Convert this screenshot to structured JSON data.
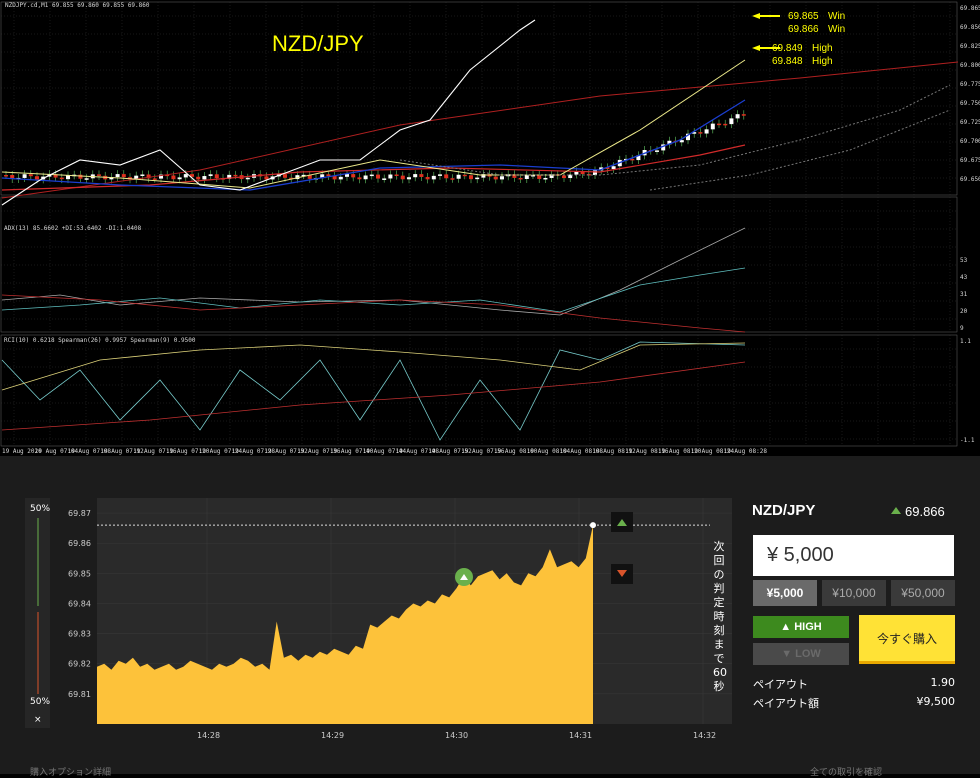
{
  "mt4": {
    "header_text": "NZDJPY.cd,M1  69.855 69.860 69.855 69.860",
    "pair_label": "NZD/JPY",
    "annotations": [
      {
        "price": "69.865",
        "label": "Win"
      },
      {
        "price": "69.866",
        "label": "Win"
      },
      {
        "price": "69.849",
        "label": "High"
      },
      {
        "price": "69.848",
        "label": "High"
      }
    ],
    "adx_label": "ADX(13) 85.6602 +DI:53.6402 -DI:1.0408",
    "rci_label": "RCI(10) 0.6218  Spearman(26) 0.9957  Spearman(9) 0.9500",
    "price_axis": [
      "69.865",
      "69.850",
      "69.825",
      "69.800",
      "69.775",
      "69.750",
      "69.725",
      "69.700",
      "69.675",
      "69.650"
    ],
    "adx_axis": [
      "53",
      "43",
      "31",
      "20",
      "9"
    ],
    "rci_axis": [
      "1.1",
      "",
      "",
      "-1.1"
    ],
    "time_axis": [
      "19 Aug 2020",
      "19 Aug 07:04",
      "19 Aug 07:08",
      "19 Aug 07:12",
      "19 Aug 07:16",
      "19 Aug 07:20",
      "19 Aug 07:24",
      "19 Aug 07:28",
      "19 Aug 07:32",
      "19 Aug 07:36",
      "19 Aug 07:40",
      "19 Aug 07:44",
      "19 Aug 07:48",
      "19 Aug 07:52",
      "19 Aug 07:56",
      "19 Aug 08:00",
      "19 Aug 08:04",
      "19 Aug 08:08",
      "19 Aug 08:12",
      "19 Aug 08:16",
      "19 Aug 08:20",
      "19 Aug 08:24",
      "19 Aug 08:28"
    ]
  },
  "highlow": {
    "pct_top": "50%",
    "pct_bottom": "50%",
    "close_x": "×",
    "y_axis": [
      "69.87",
      "69.86",
      "69.85",
      "69.84",
      "69.83",
      "69.82",
      "69.81"
    ],
    "x_axis": [
      "14:28",
      "14:29",
      "14:30",
      "14:31",
      "14:32"
    ],
    "countdown": [
      "次",
      "回",
      "の",
      "判",
      "定",
      "時",
      "刻",
      "ま",
      "で",
      "60",
      "秒"
    ],
    "series": [
      69.819,
      69.82,
      69.818,
      69.821,
      69.82,
      69.822,
      69.819,
      69.82,
      69.818,
      69.819,
      69.82,
      69.818,
      69.819,
      69.821,
      69.82,
      69.819,
      69.818,
      69.82,
      69.819,
      69.82,
      69.822,
      69.821,
      69.819,
      69.82,
      69.818,
      69.834,
      69.822,
      69.823,
      69.821,
      69.823,
      69.822,
      69.824,
      69.823,
      69.825,
      69.824,
      69.823,
      69.826,
      69.825,
      69.833,
      69.832,
      69.834,
      69.836,
      69.835,
      69.838,
      69.84,
      69.839,
      69.841,
      69.84,
      69.843,
      69.842,
      69.845,
      69.849,
      69.846,
      69.849,
      69.85,
      69.851,
      69.848,
      69.85,
      69.847,
      69.846,
      69.85,
      69.849,
      69.852,
      69.858,
      69.852,
      69.853,
      69.854,
      69.852,
      69.855,
      69.866
    ],
    "ref_price": 69.866,
    "ylim": [
      69.8,
      69.875
    ]
  },
  "trade": {
    "pair": "NZD/JPY",
    "price": "69.866",
    "amount": "¥ 5,000",
    "chips": [
      "¥5,000",
      "¥10,000",
      "¥50,000"
    ],
    "high_label": "HIGH",
    "low_label": "LOW",
    "buy_label": "今すぐ購入",
    "payout_label": "ペイアウト",
    "payout_value": "1.90",
    "payout_amount_label": "ペイアウト額",
    "payout_amount_value": "¥9,500"
  },
  "footer": {
    "left": "購入オプション詳細",
    "right": "全ての取引を確認"
  },
  "colors": {
    "accent_green": "#3d8a1e",
    "buy_yellow": "#ffe236",
    "area": "#fdc23a"
  }
}
